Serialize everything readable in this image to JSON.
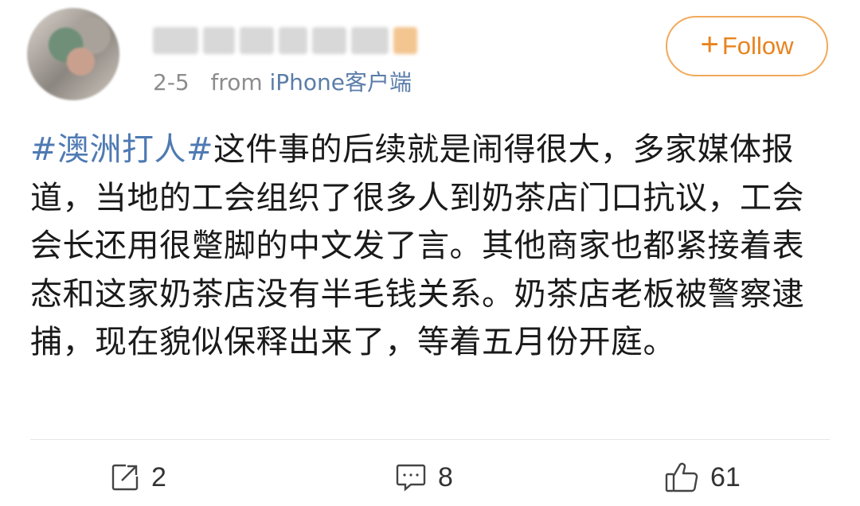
{
  "post": {
    "meta": {
      "date": "2-5",
      "from_label": "from",
      "source": "iPhone客户端"
    },
    "follow_label": "Follow",
    "hashtag": "#澳洲打人#",
    "body": "这件事的后续就是闹得很大，多家媒体报道，当地的工会组织了很多人到奶茶店门口抗议，工会会长还用很蹩脚的中文发了言。其他商家也都紧接着表态和这家奶茶店没有半毛钱关系。奶茶店老板被警察逮捕，现在貌似保释出来了，等着五月份开庭。"
  },
  "actions": {
    "repost": {
      "icon": "repost-icon",
      "count": "2"
    },
    "comment": {
      "icon": "comment-icon",
      "count": "8"
    },
    "like": {
      "icon": "thumbs-up-icon",
      "count": "61"
    }
  },
  "colors": {
    "accent": "#e8831e",
    "hashtag": "#4f7ab3",
    "source_link": "#5b7da8",
    "muted": "#8c8c8c"
  }
}
